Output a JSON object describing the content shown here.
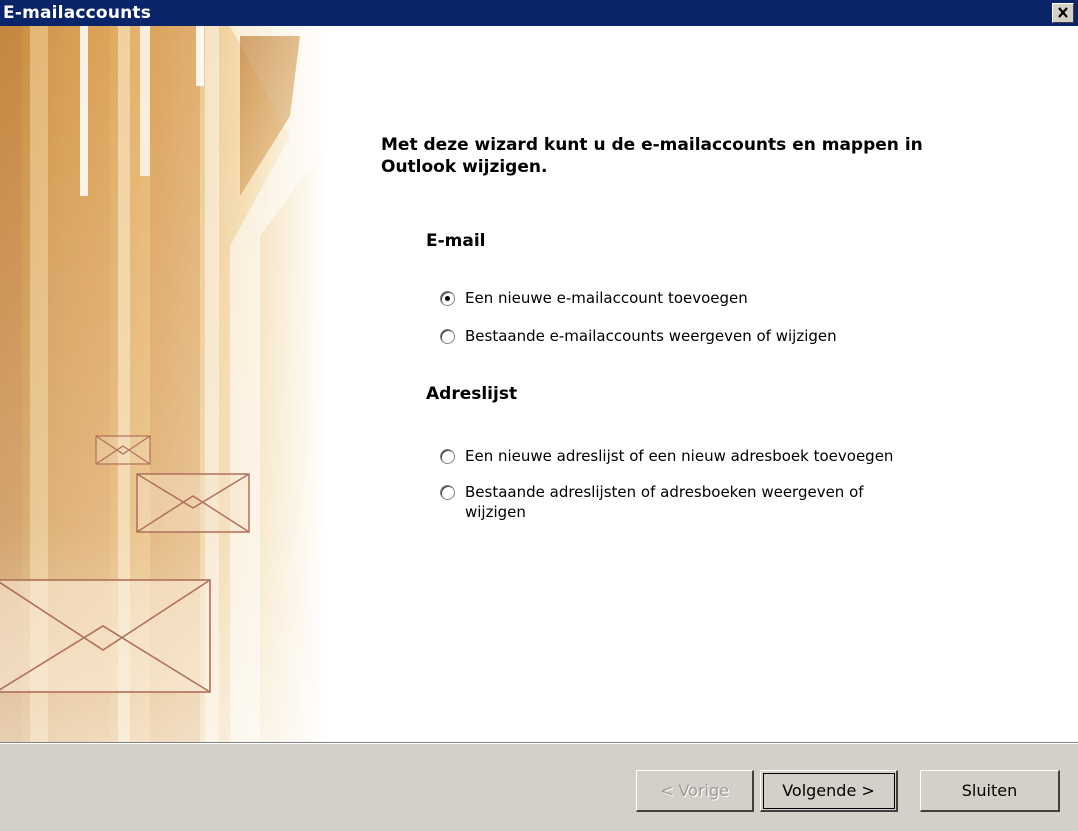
{
  "window": {
    "title": "E-mailaccounts"
  },
  "title_bar": {
    "close_glyph": "✕",
    "close_icon": "close-icon"
  },
  "wizard": {
    "intro": "Met deze wizard kunt u de e-mailaccounts en mappen in Outlook wijzigen.",
    "email": {
      "heading": "E-mail",
      "options": [
        {
          "label": "Een nieuwe e-mailaccount toevoegen",
          "selected": true
        },
        {
          "label": "Bestaande e-mailaccounts weergeven of wijzigen",
          "selected": false
        }
      ]
    },
    "addressbook": {
      "heading": "Adreslijst",
      "options": [
        {
          "label": "Een nieuwe adreslijst of een nieuw adresboek toevoegen",
          "selected": false
        },
        {
          "label": "Bestaande adreslijsten of adresboeken weergeven of wijzigen",
          "selected": false
        }
      ]
    }
  },
  "buttons": {
    "back": {
      "label": "< Vorige",
      "enabled": false
    },
    "next": {
      "label": "Volgende >",
      "enabled": true
    },
    "close": {
      "label": "Sluiten",
      "enabled": true
    }
  },
  "colors": {
    "titlebar": "#0a246a",
    "dialog_face": "#d4d0c8",
    "art_gold": "#d9a55a",
    "envelope_stroke": "#b0705a"
  }
}
